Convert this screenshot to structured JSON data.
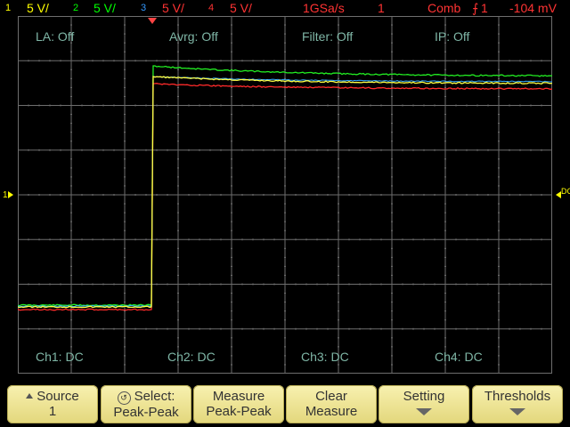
{
  "status_bar": {
    "ch1": {
      "num": "1",
      "scale": "5 V/",
      "color": "#ffff00"
    },
    "ch2": {
      "num": "2",
      "scale": "5 V/",
      "color": "#00ff00"
    },
    "ch3": {
      "num": "3",
      "scale": "5 V/",
      "color": "#3399ff"
    },
    "ch4": {
      "num": "4",
      "scale": "5 V/",
      "color": "#ff3333"
    },
    "sample_rate": "1GSa/s",
    "run_mode": "1",
    "trigger_mode": "Comb",
    "trigger_source": "1",
    "trigger_level": "-104 mV"
  },
  "screen": {
    "la": "LA: Off",
    "avrg": "Avrg: Off",
    "filter": "Filter: Off",
    "ip": "IP: Off",
    "ch1_coupling": "Ch1: DC",
    "ch2_coupling": "Ch2: DC",
    "ch3_coupling": "Ch3: DC",
    "ch4_coupling": "Ch4: DC",
    "right_marker": "DC"
  },
  "softkeys": {
    "source": {
      "line1": "Source",
      "line2": "1"
    },
    "select": {
      "line1": "Select:",
      "line2": "Peak-Peak"
    },
    "measure": {
      "line1": "Measure",
      "line2": "Peak-Peak"
    },
    "clear": {
      "line1": "Clear",
      "line2": "Measure"
    },
    "setting": {
      "line1": "Setting"
    },
    "thresholds": {
      "line1": "Thresholds"
    }
  },
  "colors": {
    "grid": "#6e6e6e",
    "text_dim": "#7fb6a6",
    "softkey_bg": "#f1e79c"
  }
}
